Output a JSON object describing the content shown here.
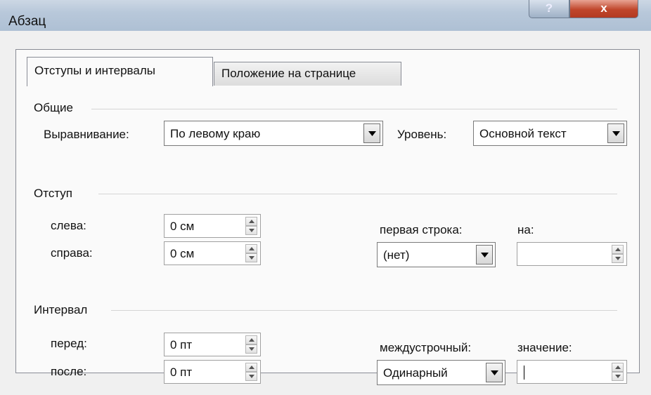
{
  "window": {
    "title": "Абзац",
    "help_label": "?",
    "close_label": "x"
  },
  "tabs": [
    {
      "label": "Отступы и интервалы",
      "selected": true
    },
    {
      "label": "Положение на странице",
      "selected": false
    }
  ],
  "general": {
    "heading": "Общие",
    "alignment_label": "Выравнивание:",
    "alignment_value": "По левому краю",
    "level_label": "Уровень:",
    "level_value": "Основной текст"
  },
  "indent": {
    "heading": "Отступ",
    "left_label": "слева:",
    "left_value": "0 см",
    "right_label": "справа:",
    "right_value": "0 см",
    "first_line_label": "первая строка:",
    "first_line_value": "(нет)",
    "by_label": "на:",
    "by_value": ""
  },
  "spacing": {
    "heading": "Интервал",
    "before_label": "перед:",
    "before_value": "0 пт",
    "after_label": "после:",
    "after_value": "0 пт",
    "line_spacing_label": "междустрочный:",
    "line_spacing_value": "Одинарный",
    "at_label": "значение:",
    "at_value": ""
  }
}
